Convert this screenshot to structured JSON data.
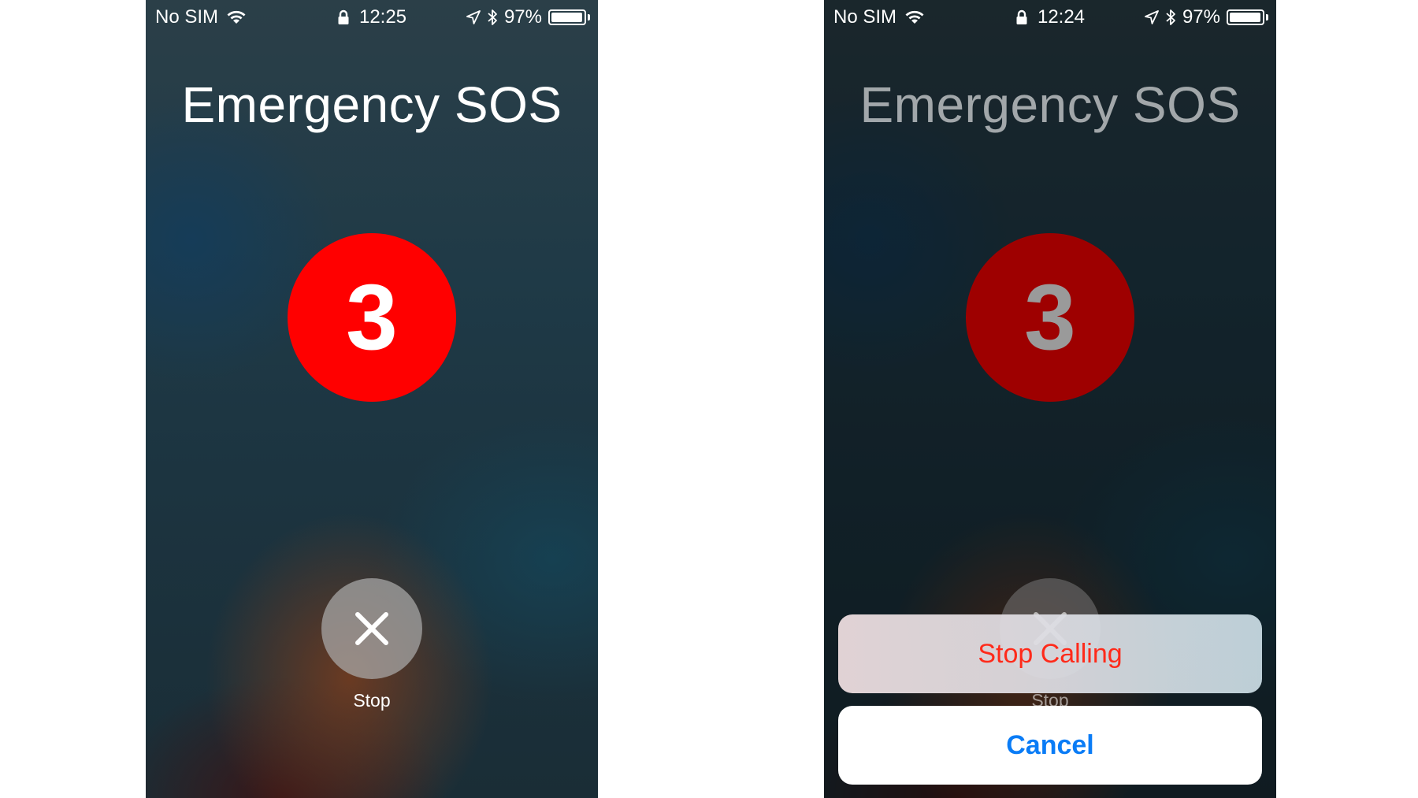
{
  "screens": [
    {
      "status": {
        "carrier": "No SIM",
        "time": "12:25",
        "battery": "97%",
        "battery_level": 0.97
      },
      "title": "Emergency SOS",
      "countdown": "3",
      "stop_label": "Stop"
    },
    {
      "status": {
        "carrier": "No SIM",
        "time": "12:24",
        "battery": "97%",
        "battery_level": 0.97
      },
      "title": "Emergency SOS",
      "countdown": "3",
      "stop_label": "Stop",
      "action_sheet": {
        "stop_calling": "Stop Calling",
        "cancel": "Cancel"
      }
    }
  ],
  "colors": {
    "countdown_red": "#ff0000",
    "countdown_red_dimmed": "#9e0000",
    "destructive_text": "#ff2a1a",
    "cancel_text": "#0a7cf6"
  },
  "icons": [
    "wifi-icon",
    "lock-icon",
    "location-icon",
    "bluetooth-icon",
    "battery-icon",
    "close-icon"
  ]
}
